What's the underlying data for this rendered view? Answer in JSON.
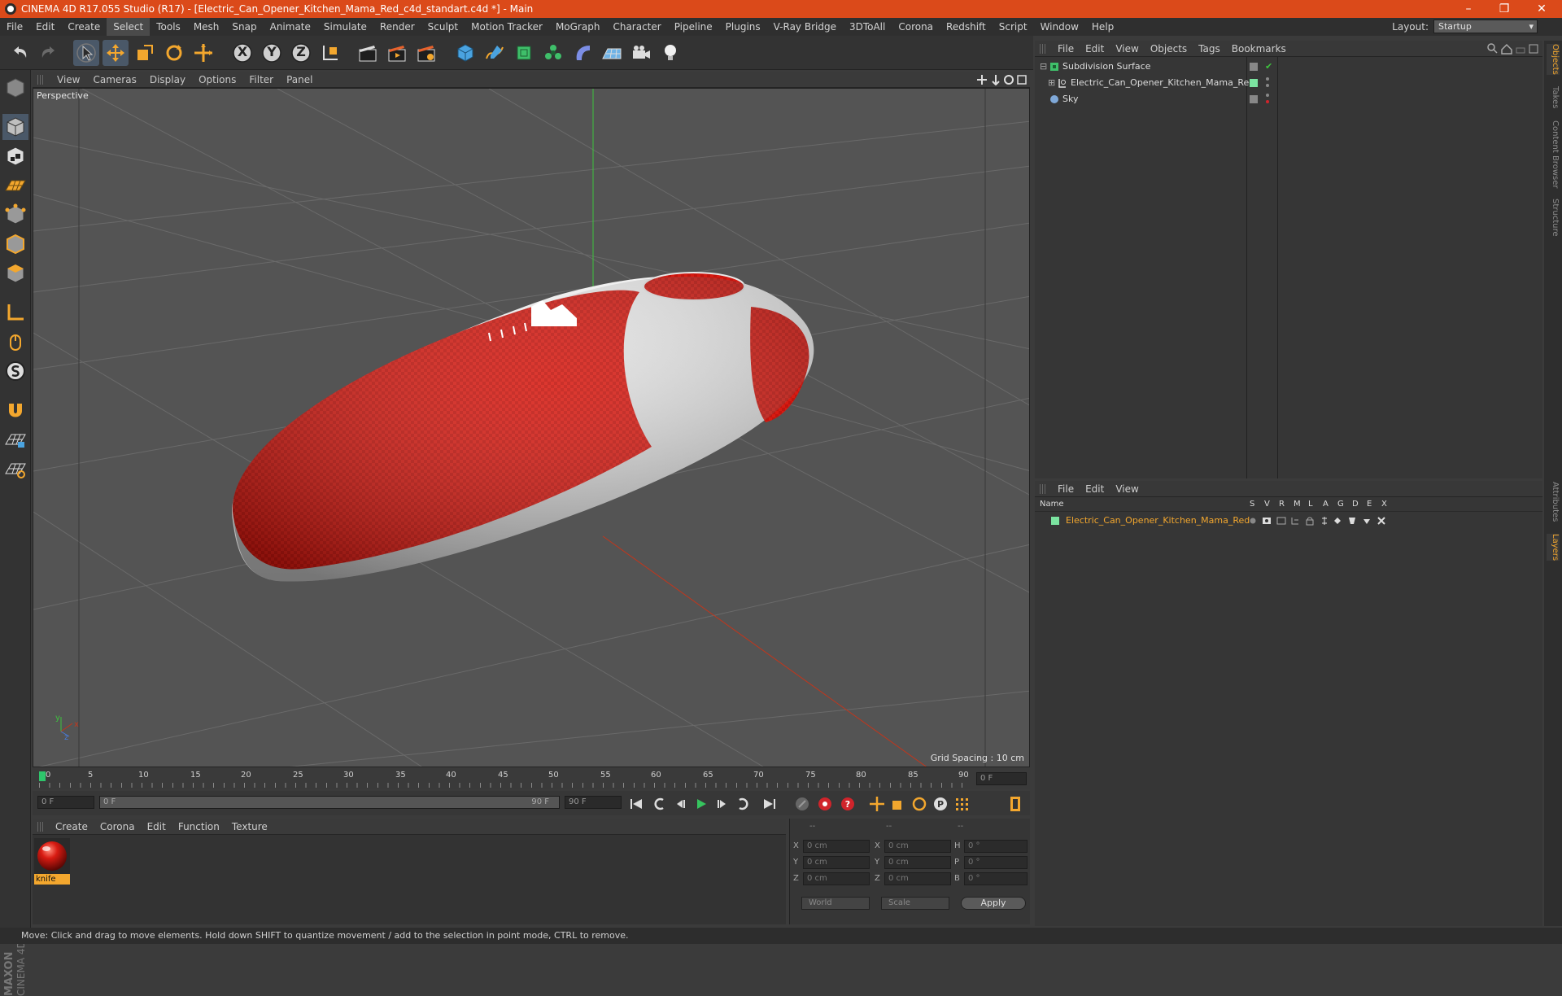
{
  "window": {
    "title": "CINEMA 4D R17.055 Studio (R17) - [Electric_Can_Opener_Kitchen_Mama_Red_c4d_standart.c4d *] - Main",
    "minimize": "–",
    "restore": "❐",
    "close": "✕"
  },
  "menu": [
    "File",
    "Edit",
    "Create",
    "Select",
    "Tools",
    "Mesh",
    "Snap",
    "Animate",
    "Simulate",
    "Render",
    "Sculpt",
    "Motion Tracker",
    "MoGraph",
    "Character",
    "Pipeline",
    "Plugins",
    "V-Ray Bridge",
    "3DToAll",
    "Corona",
    "Redshift",
    "Script",
    "Window",
    "Help"
  ],
  "active_menu": "Select",
  "layout": {
    "label": "Layout:",
    "value": "Startup"
  },
  "toolbar": {
    "x_axis": "X",
    "y_axis": "Y",
    "z_axis": "Z"
  },
  "viewport": {
    "menu": [
      "View",
      "Cameras",
      "Display",
      "Options",
      "Filter",
      "Panel"
    ],
    "label": "Perspective",
    "grid_spacing": "Grid Spacing : 10 cm",
    "axis_y": "y",
    "axis_x": "x",
    "axis_z": "z"
  },
  "timeline": {
    "ticks": [
      "0",
      "5",
      "10",
      "15",
      "20",
      "25",
      "30",
      "35",
      "40",
      "45",
      "50",
      "55",
      "60",
      "65",
      "70",
      "75",
      "80",
      "85",
      "90"
    ],
    "current": "0 F",
    "start": "0 F",
    "range_start": "0 F",
    "range_end": "90 F",
    "end": "90 F"
  },
  "materials": {
    "menu": [
      "Create",
      "Corona",
      "Edit",
      "Function",
      "Texture"
    ],
    "items": [
      {
        "name": "knife"
      }
    ]
  },
  "coordinates": {
    "header": [
      "--",
      "--",
      "--"
    ],
    "rows": [
      {
        "a": "X",
        "av": "0 cm",
        "b": "X",
        "bv": "0 cm",
        "c": "H",
        "cv": "0 °"
      },
      {
        "a": "Y",
        "av": "0 cm",
        "b": "Y",
        "bv": "0 cm",
        "c": "P",
        "cv": "0 °"
      },
      {
        "a": "Z",
        "av": "0 cm",
        "b": "Z",
        "bv": "0 cm",
        "c": "B",
        "cv": "0 °"
      }
    ],
    "mode": "World",
    "transform": "Scale",
    "apply": "Apply"
  },
  "object_manager": {
    "menu": [
      "File",
      "Edit",
      "View",
      "Objects",
      "Tags",
      "Bookmarks"
    ],
    "objects": [
      {
        "name": "Subdivision Surface"
      },
      {
        "name": "Electric_Can_Opener_Kitchen_Mama_Red"
      },
      {
        "name": "Sky"
      }
    ]
  },
  "layer_manager": {
    "menu": [
      "File",
      "Edit",
      "View"
    ],
    "columns": [
      "Name",
      "S",
      "V",
      "R",
      "M",
      "L",
      "A",
      "G",
      "D",
      "E",
      "X"
    ],
    "layers": [
      {
        "name": "Electric_Can_Opener_Kitchen_Mama_Red",
        "color": "#7be3a0"
      }
    ]
  },
  "right_tabs": [
    "Objects",
    "Takes",
    "Content Browser",
    "Structure",
    "Attributes",
    "Layers"
  ],
  "status": "Move: Click and drag to move elements. Hold down SHIFT to quantize movement / add to the selection in point mode, CTRL to remove.",
  "brand": {
    "line1": "MAXON",
    "line2": "CINEMA 4D"
  },
  "colors": {
    "title_bar": "#db4a1a",
    "accent_orange": "#f3a72e",
    "object_red": "#d81b12"
  }
}
